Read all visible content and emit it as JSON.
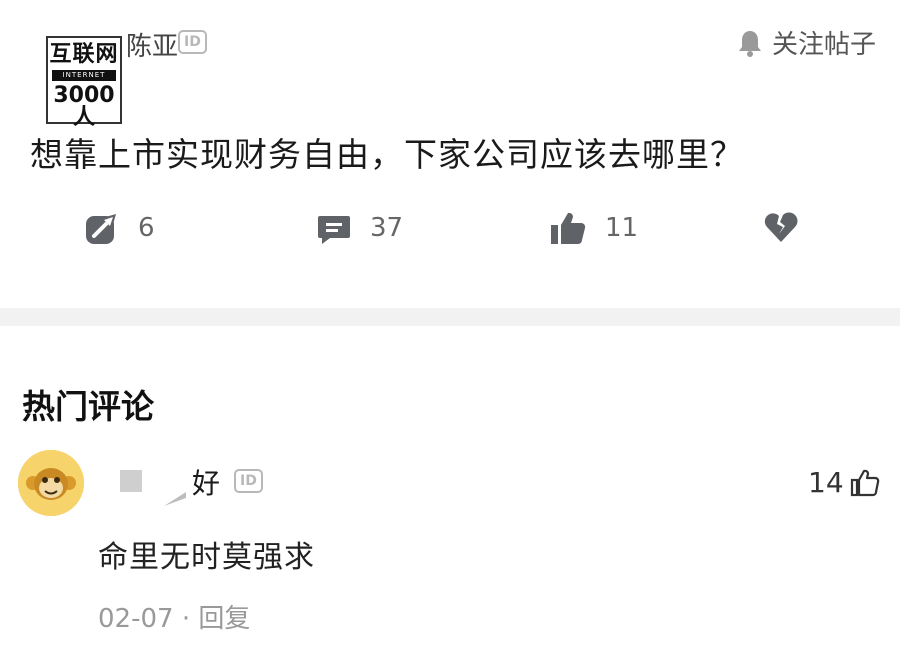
{
  "post": {
    "author_name": "陈亚",
    "id_badge": "ID",
    "follow_label": "关注帖子",
    "title": "想靠上市实现财务自由，下家公司应该去哪里？",
    "actions": {
      "share_count": "6",
      "comment_count": "37",
      "like_count": "11"
    }
  },
  "watermark": {
    "top": "互联网",
    "mid": "INTERNET",
    "bottom": "3000人"
  },
  "comments": {
    "section_title": "热门评论",
    "items": [
      {
        "user_name": "好",
        "id_badge": "ID",
        "like_count": "14",
        "text": "命里无时莫强求",
        "meta": "02-07 · 回复"
      }
    ]
  },
  "colors": {
    "icon_gray": "#5f6368",
    "divider": "#f2f2f2",
    "avatar_bg": "#f6d36b"
  }
}
